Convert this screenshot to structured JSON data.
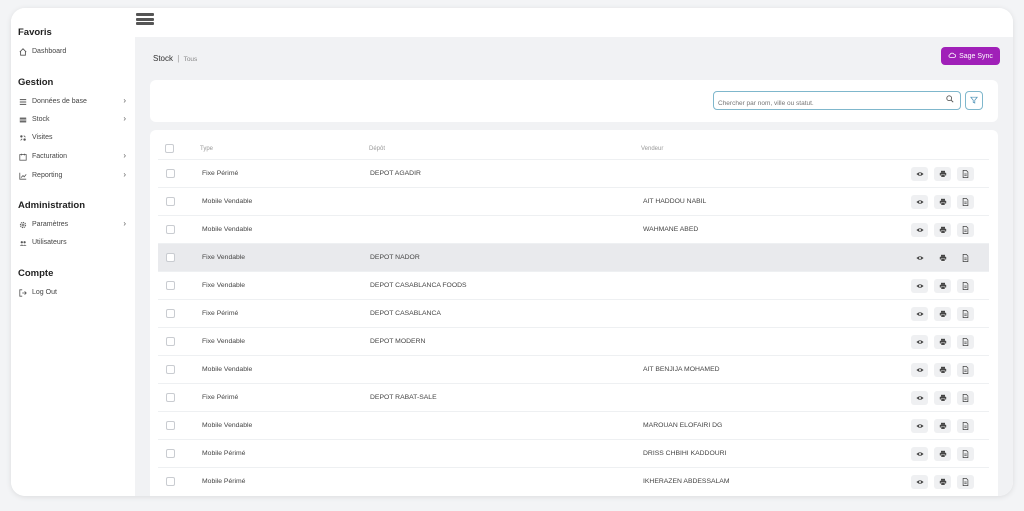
{
  "sidebar": {
    "sections": [
      {
        "title": "Favoris",
        "items": [
          {
            "label": "Dashboard",
            "icon": "home-icon",
            "chevron": false
          }
        ]
      },
      {
        "title": "Gestion",
        "items": [
          {
            "label": "Données de base",
            "icon": "list-icon",
            "chevron": true
          },
          {
            "label": "Stock",
            "icon": "stock-icon",
            "chevron": true
          },
          {
            "label": "Visites",
            "icon": "visits-icon",
            "chevron": false
          },
          {
            "label": "Facturation",
            "icon": "billing-icon",
            "chevron": true
          },
          {
            "label": "Reporting",
            "icon": "chart-icon",
            "chevron": true
          }
        ]
      },
      {
        "title": "Administration",
        "items": [
          {
            "label": "Paramètres",
            "icon": "gear-icon",
            "chevron": true
          },
          {
            "label": "Utilisateurs",
            "icon": "users-icon",
            "chevron": false
          }
        ]
      },
      {
        "title": "Compte",
        "items": [
          {
            "label": "Log Out",
            "icon": "logout-icon",
            "chevron": false
          }
        ]
      }
    ]
  },
  "breadcrumb": {
    "section": "Stock",
    "separator": "|",
    "current": "Tous"
  },
  "sage_button": {
    "label": "Sage Sync",
    "color": "#a020b8"
  },
  "search": {
    "placeholder": "Chercher par nom, ville ou statut.",
    "value": ""
  },
  "table": {
    "headers": {
      "type": "Type",
      "depot": "Dépôt",
      "vendeur": "Vendeur"
    },
    "rows": [
      {
        "type": "Fixe Périmé",
        "depot": "DEPOT AGADIR",
        "vendeur": ""
      },
      {
        "type": "Mobile Vendable",
        "depot": "",
        "vendeur": "AIT HADDOU NABIL"
      },
      {
        "type": "Mobile Vendable",
        "depot": "",
        "vendeur": "WAHMANE ABED"
      },
      {
        "type": "Fixe Vendable",
        "depot": "DEPOT NADOR",
        "vendeur": ""
      },
      {
        "type": "Fixe Vendable",
        "depot": "DEPOT CASABLANCA FOODS",
        "vendeur": ""
      },
      {
        "type": "Fixe Périmé",
        "depot": "DEPOT CASABLANCA",
        "vendeur": ""
      },
      {
        "type": "Fixe Vendable",
        "depot": "DEPOT MODERN",
        "vendeur": ""
      },
      {
        "type": "Mobile Vendable",
        "depot": "",
        "vendeur": "AIT BENJIJA MOHAMED"
      },
      {
        "type": "Fixe Périmé",
        "depot": "DEPOT RABAT-SALE",
        "vendeur": ""
      },
      {
        "type": "Mobile Vendable",
        "depot": "",
        "vendeur": "MAROUAN ELOFAIRI DG"
      },
      {
        "type": "Mobile Périmé",
        "depot": "",
        "vendeur": "DRISS CHBIHI KADDOURI"
      },
      {
        "type": "Mobile Périmé",
        "depot": "",
        "vendeur": "IKHERAZEN ABDESSALAM"
      }
    ],
    "row_actions": [
      "eye-icon",
      "print-icon",
      "document-icon"
    ]
  }
}
